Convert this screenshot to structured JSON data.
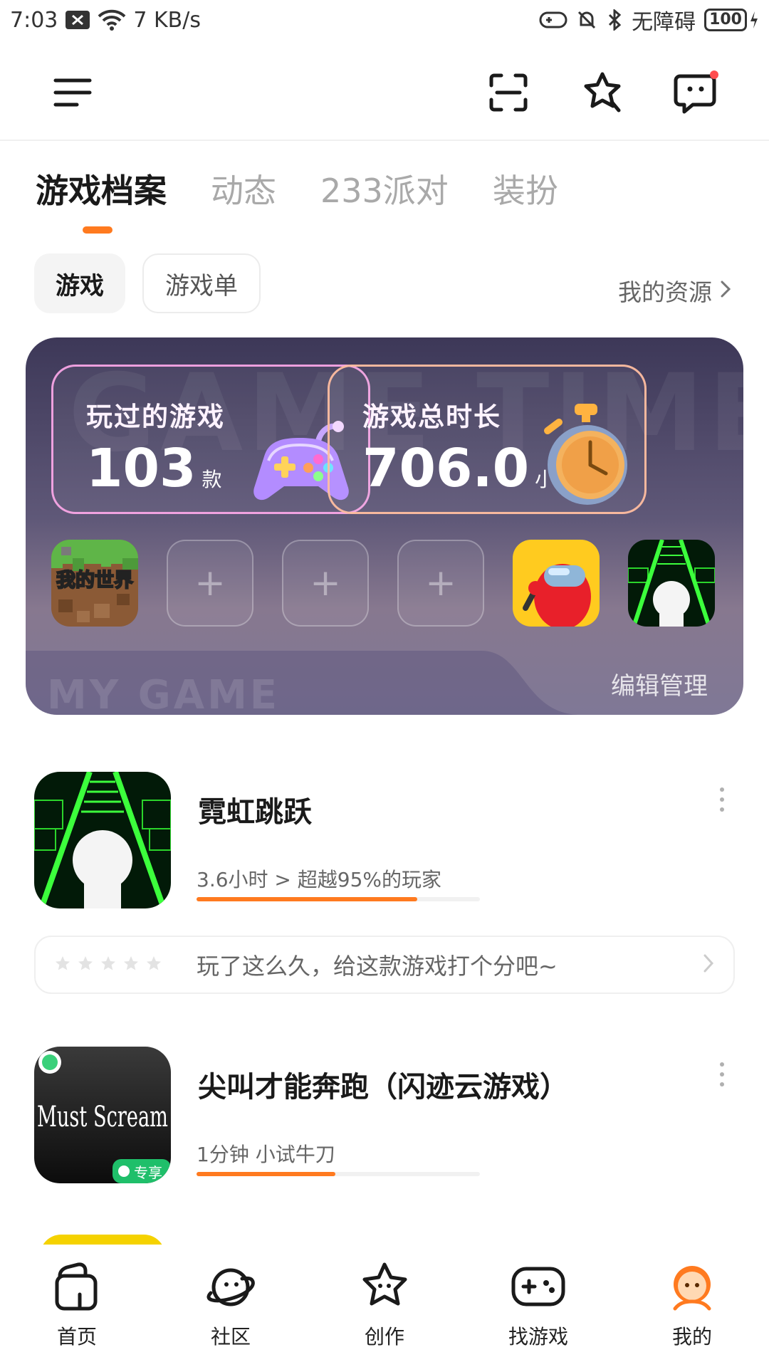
{
  "status_bar": {
    "time": "7:03",
    "net_speed": "7 KB/s",
    "accessibility": "无障碍",
    "battery": "100"
  },
  "top_bar": {
    "icons": [
      "menu-icon",
      "scan-icon",
      "star-icon",
      "message-icon"
    ]
  },
  "tabs": {
    "main": [
      "游戏档案",
      "动态",
      "233派对",
      "装扮"
    ],
    "active": "游戏档案",
    "sub": [
      "游戏",
      "游戏单"
    ],
    "resources_link": "我的资源"
  },
  "stats_card": {
    "played_label": "玩过的游戏",
    "played_value": "103",
    "played_unit": "款",
    "time_label": "游戏总时长",
    "time_value": "706.0",
    "time_unit": "小时",
    "slot_minecraft_text": "我的世界",
    "edit_label": "编辑管理",
    "watermark_top": "GAME TIME",
    "watermark_bottom": "MY GAME"
  },
  "games": [
    {
      "title": "霓虹跳跃",
      "meta": "3.6小时 > 超越95%的玩家",
      "progress": 0.78
    },
    {
      "title": "尖叫才能奔跑（闪迹云游戏）",
      "meta": "1分钟 小试牛刀",
      "progress": 0.49,
      "thumb_text": "Must Scream",
      "badge_text": "专享"
    }
  ],
  "rating_prompt": "玩了这么久，给这款游戏打个分吧~",
  "bottom_nav": [
    {
      "label": "首页",
      "icon": "home-icon"
    },
    {
      "label": "社区",
      "icon": "planet-icon"
    },
    {
      "label": "创作",
      "icon": "star-create-icon"
    },
    {
      "label": "找游戏",
      "icon": "gamepad-icon"
    },
    {
      "label": "我的",
      "icon": "profile-icon"
    }
  ],
  "colors": {
    "accent": "#ff7a1f",
    "card_top": "#3d3858",
    "card_bottom": "#87788f"
  }
}
